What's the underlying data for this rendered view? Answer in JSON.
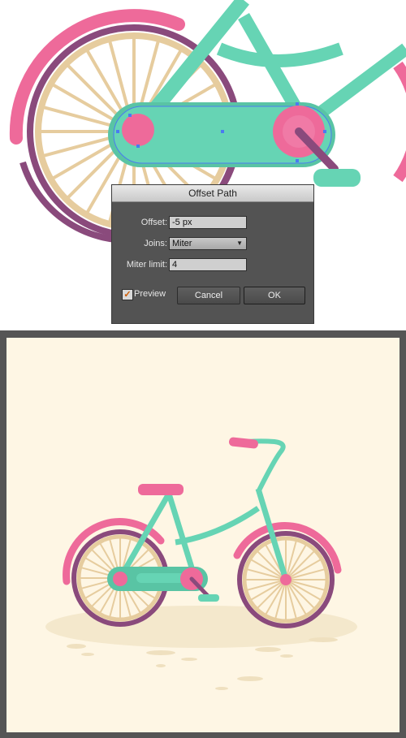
{
  "dialog": {
    "title": "Offset Path",
    "offset_label": "Offset:",
    "offset_value": "-5 px",
    "joins_label": "Joins:",
    "joins_value": "Miter",
    "miter_label": "Miter limit:",
    "miter_value": "4",
    "preview_label": "Preview",
    "preview_checked": true,
    "cancel_label": "Cancel",
    "ok_label": "OK"
  },
  "colors": {
    "teal": "#66d4b4",
    "pink": "#ee6a9a",
    "purple": "#8a4a7c",
    "rim": "#e6cc9e",
    "cream_bg": "#fef6e4",
    "shadow": "#f4e8cc",
    "dialog_bg": "#535353"
  }
}
